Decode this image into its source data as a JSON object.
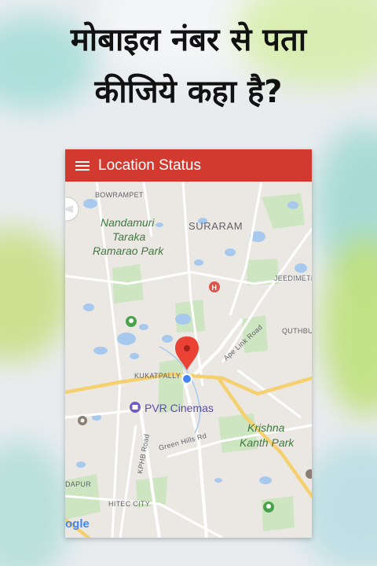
{
  "headline": {
    "line1": "मोबाइल नंबर से पता",
    "line2": "कीजिये कहा है?"
  },
  "app": {
    "title": "Location Status",
    "menu_icon": "hamburger-menu-icon",
    "accent_color": "#d23a30"
  },
  "map": {
    "labels": {
      "bowrampet": "BOWRAMPET",
      "nandamuri_1": "Nandamuri",
      "nandamuri_2": "Taraka",
      "nandamuri_3": "Ramarao Park",
      "suraram": "SURARAM",
      "jeedimetla": "JEEDIMETL",
      "quthbullapur": "QUTHBU",
      "apelink": "Ape Link Road",
      "kukatpally": "KUKATPALLY",
      "pvr": "PVR Cinemas",
      "krishna_1": "Krishna",
      "krishna_2": "Kanth Park",
      "kphb": "KPHB Road",
      "greenhills": "Green Hills Rd",
      "dapur": "DAPUR",
      "hitec": "HITEC CITY",
      "google": "ogle"
    },
    "icons": [
      "location-pin-icon",
      "current-location-dot-icon",
      "hospital-icon",
      "park-icon",
      "cinema-icon",
      "compass-icon"
    ]
  }
}
